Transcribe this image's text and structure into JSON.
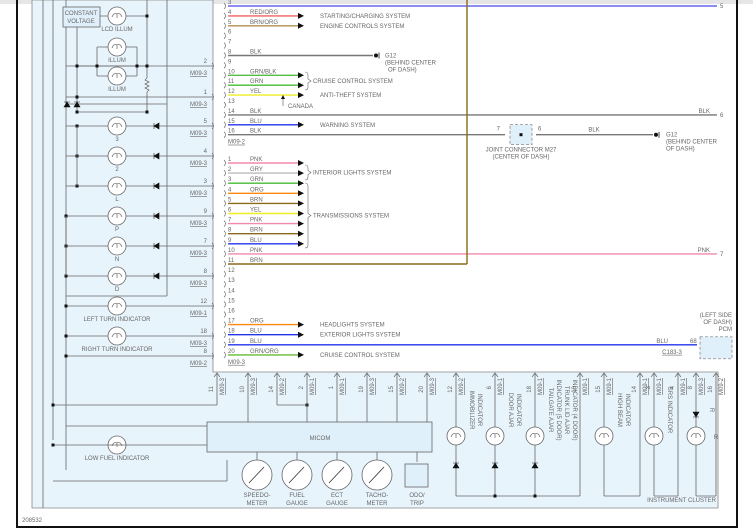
{
  "figure_id": "208532",
  "cluster_label": "INSTRUMENT CLUSTER",
  "colors": {
    "cluster_fill": "#e8f4fc",
    "line": "#666666",
    "RED/ORG": "#f06060",
    "BRN/ORG": "#b09050",
    "BLK": "#777777",
    "GRN/BLK": "#55bb44",
    "GRN": "#44bb33",
    "YEL": "#eeee22",
    "BLU": "#2233ee",
    "PNK": "#f08aa8",
    "GRY": "#bbbbbb",
    "ORG": "#ff8811",
    "BRN": "#8a6a1a",
    "GRN/ORG": "#66bb33",
    "BLU/ORG": "#6666ee"
  },
  "connector_a": {
    "name": "M09-2",
    "pins": [
      {
        "pin": "3",
        "color": "BLU/ORG",
        "label": "",
        "system": "",
        "far_pin": "5",
        "kind": "long"
      },
      {
        "pin": "4",
        "color": "RED/ORG",
        "label": "RED/ORG",
        "system": "STARTING/CHARGING SYSTEM",
        "kind": "arrow"
      },
      {
        "pin": "5",
        "color": "BRN/ORG",
        "label": "BRN/ORG",
        "system": "ENGINE CONTROLS SYSTEM",
        "kind": "arrow"
      },
      {
        "pin": "6",
        "kind": "none"
      },
      {
        "pin": "7",
        "kind": "none"
      },
      {
        "pin": "8",
        "color": "BLK",
        "label": "BLK",
        "kind": "ground"
      },
      {
        "pin": "9",
        "kind": "none"
      },
      {
        "pin": "10",
        "color": "GRN/BLK",
        "label": "GRN/BLK",
        "kind": "arrow"
      },
      {
        "pin": "11",
        "color": "GRN",
        "label": "GRN",
        "kind": "arrow"
      },
      {
        "pin": "12",
        "color": "YEL",
        "label": "YEL",
        "system": "ANTI-THEFT SYSTEM",
        "kind": "arrow"
      },
      {
        "pin": "13",
        "kind": "none"
      },
      {
        "pin": "14",
        "color": "BLK",
        "label": "BLK",
        "far_label": "BLK",
        "far_pin": "6",
        "kind": "long"
      },
      {
        "pin": "15",
        "color": "BLU",
        "label": "BLU",
        "system": "WARNING SYSTEM",
        "kind": "arrow"
      },
      {
        "pin": "16",
        "color": "BLK",
        "label": "BLK",
        "kind": "joint"
      }
    ]
  },
  "connector_b": {
    "name": "M09-3",
    "pins": [
      {
        "pin": "1",
        "color": "PNK",
        "label": "PNK",
        "kind": "arrow"
      },
      {
        "pin": "2",
        "color": "GRY",
        "label": "GRY",
        "kind": "arrow"
      },
      {
        "pin": "3",
        "color": "GRN",
        "label": "GRN",
        "kind": "arrow"
      },
      {
        "pin": "4",
        "color": "ORG",
        "label": "ORG",
        "kind": "arrow"
      },
      {
        "pin": "5",
        "color": "BRN",
        "label": "BRN",
        "kind": "arrow"
      },
      {
        "pin": "6",
        "color": "YEL",
        "label": "YEL",
        "kind": "arrow"
      },
      {
        "pin": "7",
        "color": "PNK",
        "label": "PNK",
        "kind": "arrow"
      },
      {
        "pin": "8",
        "color": "BRN",
        "label": "BRN",
        "kind": "arrow"
      },
      {
        "pin": "9",
        "color": "BLU",
        "label": "BLU",
        "kind": "arrow"
      },
      {
        "pin": "10",
        "color": "PNK",
        "label": "PNK",
        "far_label": "PNK",
        "far_pin": "7",
        "kind": "long"
      },
      {
        "pin": "11",
        "color": "BRN",
        "label": "BRN",
        "kind": "up"
      },
      {
        "pin": "12",
        "kind": "none"
      },
      {
        "pin": "13",
        "kind": "none"
      },
      {
        "pin": "14",
        "kind": "none"
      },
      {
        "pin": "15",
        "kind": "none"
      },
      {
        "pin": "16",
        "kind": "none"
      },
      {
        "pin": "17",
        "color": "ORG",
        "label": "ORG",
        "system": "HEADLIGHTS SYSTEM",
        "kind": "arrow"
      },
      {
        "pin": "18",
        "color": "BLU",
        "label": "BLU",
        "system": "EXTERIOR LIGHTS SYSTEM",
        "kind": "arrow"
      },
      {
        "pin": "19",
        "color": "BLU",
        "label": "BLU",
        "far_label": "BLU",
        "kind": "pcm"
      },
      {
        "pin": "20",
        "color": "GRN/ORG",
        "label": "GRN/ORG",
        "system": "CRUISE CONTROL SYSTEM",
        "kind": "arrow"
      }
    ]
  },
  "groups": {
    "cruise": "CRUISE CONTROL SYSTEM",
    "interior": "INTERIOR LIGHTS SYSTEM",
    "transmission": "TRANSMISSIONS SYSTEM",
    "canada": "CANADA"
  },
  "ground": {
    "name": "G12",
    "loc1": "(BEHIND CENTER",
    "loc2": "OF DASH)"
  },
  "joint": {
    "pin_in": "7",
    "pin_out": "6",
    "name": "JOINT CONNECTOR M27",
    "loc": "(CENTER OF DASH)",
    "wire": "BLK"
  },
  "pcm": {
    "loc1": "(LEFT SIDE",
    "loc2": "OF DASH)",
    "name": "PCM",
    "pin": "68",
    "connector": "C183-3"
  },
  "cluster_side_pins": [
    {
      "pin": "2",
      "conn": "M09-3"
    },
    {
      "pin": "1",
      "conn": "M09-3"
    },
    {
      "pin": "5",
      "conn": "M09-3"
    },
    {
      "pin": "4",
      "conn": "M09-3"
    },
    {
      "pin": "3",
      "conn": "M09-3"
    },
    {
      "pin": "9",
      "conn": "M09-3"
    },
    {
      "pin": "7",
      "conn": "M09-3"
    },
    {
      "pin": "8",
      "conn": "M09-3"
    },
    {
      "pin": "12",
      "conn": "M09-1"
    },
    {
      "pin": "18",
      "conn": "M09-3"
    },
    {
      "pin": "8",
      "conn": "M09-2"
    }
  ],
  "left_lamps": [
    {
      "label": "LCD ILLUM"
    },
    {
      "label": "ILLUM"
    },
    {
      "label": "ILLUM"
    },
    {
      "label": "3"
    },
    {
      "label": "2"
    },
    {
      "label": "L"
    },
    {
      "label": "P"
    },
    {
      "label": "N"
    },
    {
      "label": "D"
    },
    {
      "label": "LEFT TURN INDICATOR"
    },
    {
      "label": "RIGHT TURN INDICATOR"
    },
    {
      "label": "LOW FUEL INDICATOR"
    }
  ],
  "constant_voltage": [
    "CONSTANT",
    "VOLTAGE"
  ],
  "bottom_pins": [
    {
      "pin": "11",
      "conn": "M09-3"
    },
    {
      "pin": "10",
      "conn": "M09-3"
    },
    {
      "pin": "14",
      "conn": "M09-2"
    },
    {
      "pin": "2",
      "conn": "M09-1"
    },
    {
      "pin": "1",
      "conn": "M09-1"
    },
    {
      "pin": "19",
      "conn": "M09-3"
    },
    {
      "pin": "15",
      "conn": "M09-2"
    },
    {
      "pin": "20",
      "conn": "M09-3"
    },
    {
      "pin": "12",
      "conn": "M09-2"
    },
    {
      "pin": "6",
      "conn": "M09-1"
    },
    {
      "pin": "18",
      "conn": "M09-1"
    },
    {
      "pin": "10",
      "conn": "M09-1"
    },
    {
      "pin": "15",
      "conn": "M09-1"
    },
    {
      "pin": "14",
      "conn": "M09-1"
    },
    {
      "pin": "3",
      "conn": "M09-1"
    },
    {
      "pin": "4",
      "conn": "M09-1"
    },
    {
      "pin": "8",
      "conn": "M09-3"
    },
    {
      "pin": "16",
      "conn": "M09-2"
    }
  ],
  "micom": "MICOM",
  "gauges": [
    [
      "SPEEDO-",
      "METER"
    ],
    [
      "FUEL",
      "GAUGE"
    ],
    [
      "ECT",
      "GAUGE"
    ],
    [
      "TACHO-",
      "METER"
    ]
  ],
  "odo": [
    "ODO/",
    "TRIP"
  ],
  "indicators": [
    [
      "IMMOBILIZER",
      "INDICATOR"
    ],
    [
      "DOOR AJAR",
      "INDICATOR"
    ],
    [
      "TAILGATE AJAR",
      "INDICATOR   (5 DOOR)",
      "TRUNK LID AJAR",
      "INDICATOR   (4 DOOR)"
    ],
    [
      "HIGH BEAM",
      "INDICATOR"
    ],
    [
      "SRS INDICATOR"
    ],
    [
      "R"
    ]
  ]
}
